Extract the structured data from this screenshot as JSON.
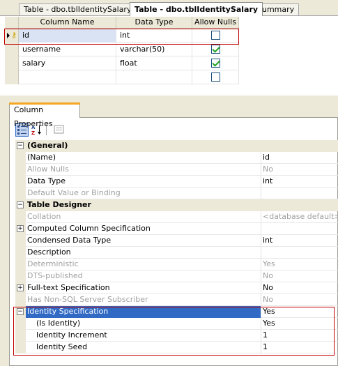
{
  "tabs": [
    {
      "label": "Table - dbo.tblIdentitySalary",
      "active": false
    },
    {
      "label": "Table - dbo.tblIdentitySalary",
      "active": true
    },
    {
      "label": "Summary",
      "active": false
    }
  ],
  "grid": {
    "headers": {
      "column_name": "Column Name",
      "data_type": "Data Type",
      "allow_nulls": "Allow Nulls"
    },
    "rows": [
      {
        "name": "id",
        "type": "int",
        "allow_nulls": false,
        "primary_key": true,
        "selected": true
      },
      {
        "name": "username",
        "type": "varchar(50)",
        "allow_nulls": true
      },
      {
        "name": "salary",
        "type": "float",
        "allow_nulls": true
      },
      {
        "name": "",
        "type": "",
        "allow_nulls": false
      }
    ]
  },
  "column_properties": {
    "tab_label": "Column Properties",
    "toolbar": {
      "categorized_icon": "categorized-icon",
      "alphabetical_icon": "alphabetical-icon",
      "property_pages_icon": "property-pages-icon"
    },
    "sections": {
      "general": "(General)",
      "table_designer": "Table Designer"
    },
    "rows": {
      "name": {
        "label": "(Name)",
        "value": "id"
      },
      "allow_nulls": {
        "label": "Allow Nulls",
        "value": "No"
      },
      "data_type": {
        "label": "Data Type",
        "value": "int"
      },
      "default_value": {
        "label": "Default Value or Binding",
        "value": ""
      },
      "collation": {
        "label": "Collation",
        "value": "<database default>"
      },
      "computed": {
        "label": "Computed Column Specification",
        "value": ""
      },
      "condensed": {
        "label": "Condensed Data Type",
        "value": "int"
      },
      "description": {
        "label": "Description",
        "value": ""
      },
      "deterministic": {
        "label": "Deterministic",
        "value": "Yes"
      },
      "dts": {
        "label": "DTS-published",
        "value": "No"
      },
      "fulltext": {
        "label": "Full-text Specification",
        "value": "No"
      },
      "nonsql": {
        "label": "Has Non-SQL Server Subscriber",
        "value": "No"
      },
      "identity_spec": {
        "label": "Identity Specification",
        "value": "Yes"
      },
      "is_identity": {
        "label": "(Is Identity)",
        "value": "Yes"
      },
      "identity_increment": {
        "label": "Identity Increment",
        "value": "1"
      },
      "identity_seed": {
        "label": "Identity Seed",
        "value": "1"
      }
    }
  },
  "colors": {
    "selection": "#316ac5",
    "highlight_box": "#c00000",
    "panel_bg": "#ece9d8",
    "tab_accent": "#f5a623"
  }
}
